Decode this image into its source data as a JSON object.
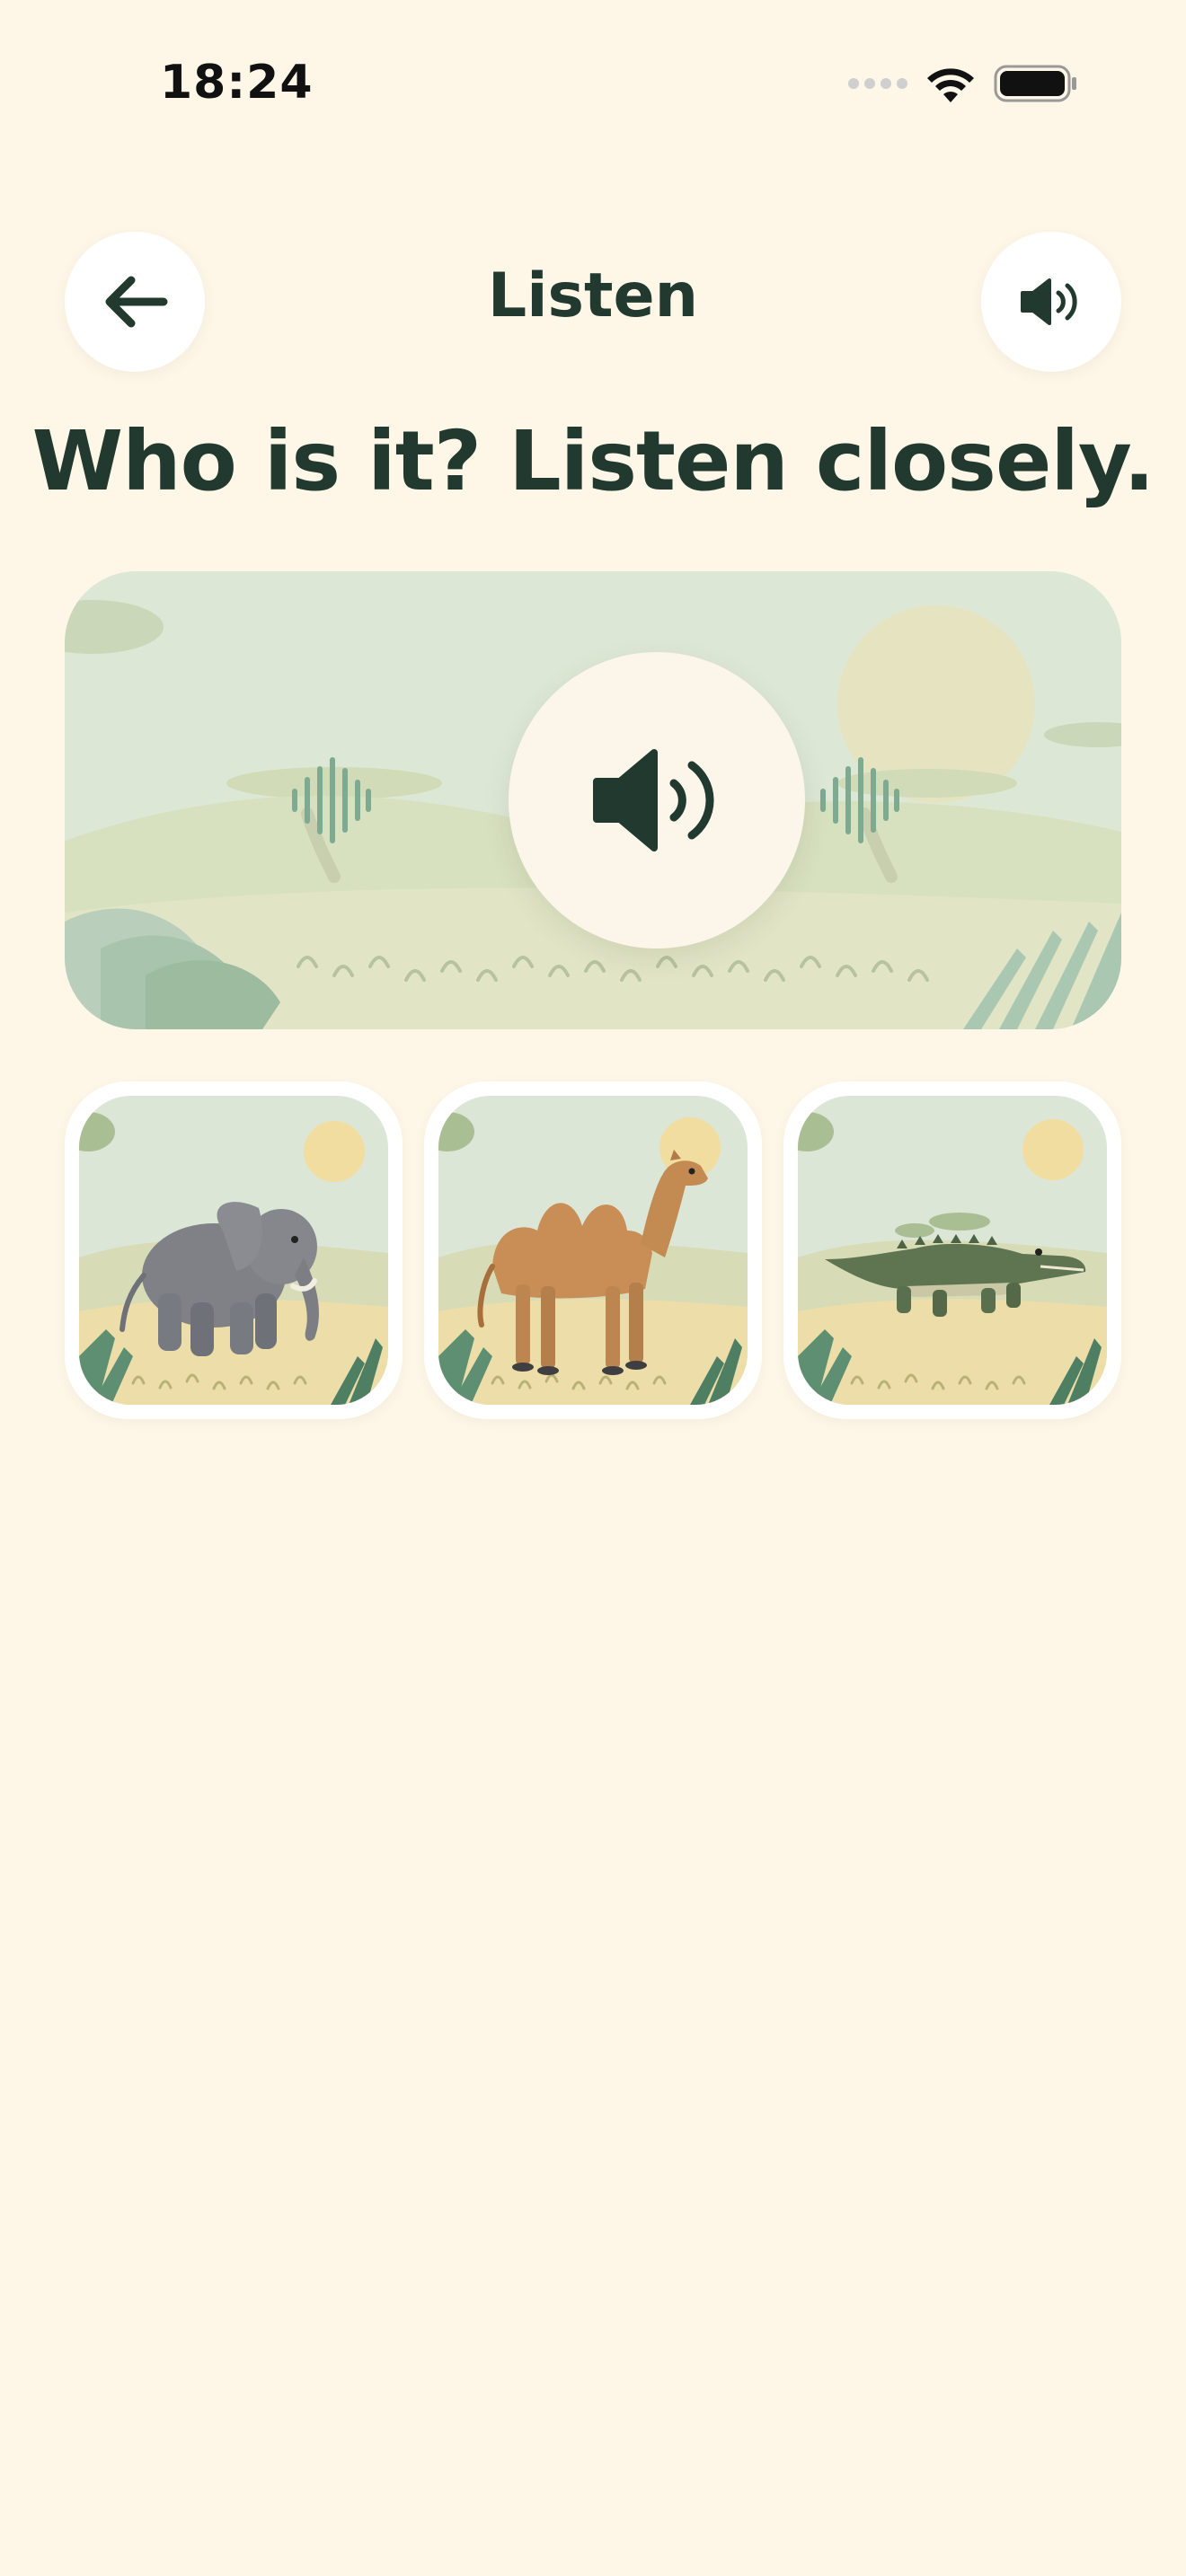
{
  "status_bar": {
    "time": "18:24"
  },
  "header": {
    "title": "Listen",
    "back_icon": "arrow-left-icon",
    "sound_icon": "speaker-icon"
  },
  "question": "Who is it? Listen closely.",
  "hero": {
    "play_icon": "speaker-icon"
  },
  "choices": [
    {
      "animal": "elephant"
    },
    {
      "animal": "camel"
    },
    {
      "animal": "crocodile"
    }
  ],
  "colors": {
    "background": "#FEF7E8",
    "text": "#22392F",
    "accent_green": "#6E9B82"
  }
}
